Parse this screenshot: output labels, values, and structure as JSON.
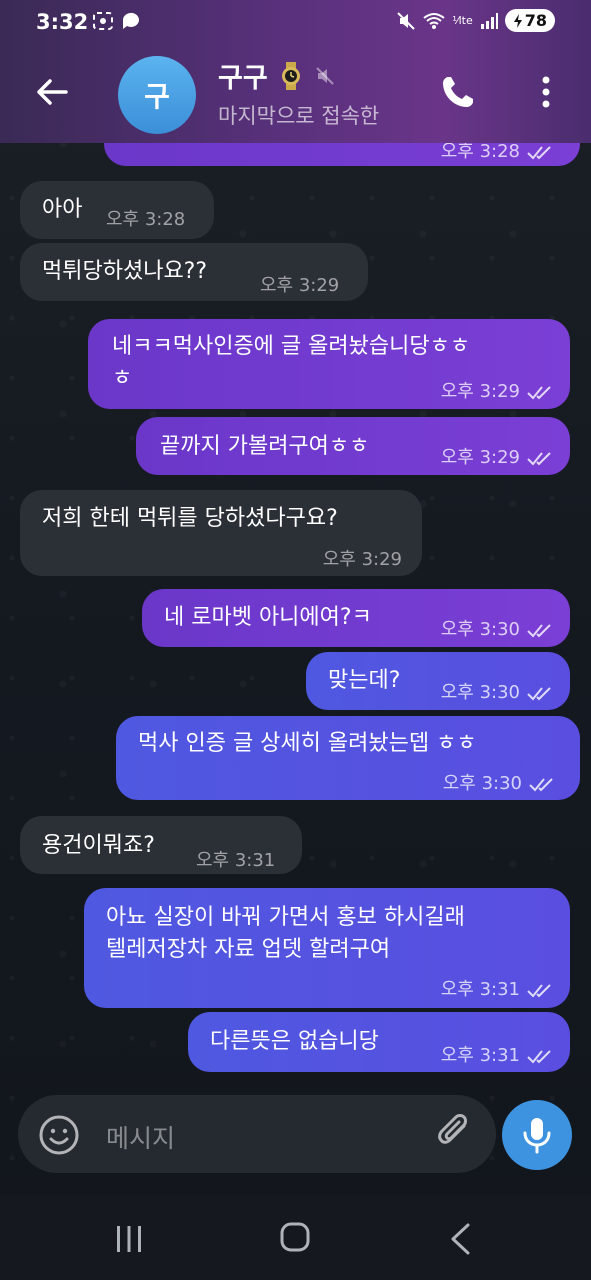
{
  "status_bar": {
    "time": "3:32",
    "network": "⅟lte",
    "battery": "78"
  },
  "header": {
    "avatar_letter": "구",
    "contact_name": "구구",
    "contact_status": "마지막으로 접속한 ",
    "colors": {
      "gradient_start": "#3a2a55",
      "gradient_end": "#6a3589"
    }
  },
  "messages": [
    {
      "dir": "out",
      "text": "",
      "time": "오후 3:28"
    },
    {
      "dir": "in",
      "text": "아아",
      "time": "오후 3:28"
    },
    {
      "dir": "in",
      "text": "먹튀당하셨나요??",
      "time": "오후 3:29"
    },
    {
      "dir": "out",
      "line1": "네ㅋㅋ먹사인증에 글 올려놨습니당ㅎㅎ",
      "line2": "ㅎ",
      "time": "오후 3:29"
    },
    {
      "dir": "out",
      "text": "끝까지 가볼려구여ㅎㅎ",
      "time": "오후 3:29"
    },
    {
      "dir": "in",
      "text": "저희 한테 먹튀를 당하셨다구요?",
      "time": "오후 3:29"
    },
    {
      "dir": "out",
      "text": "네 로마벳 아니에여?ㅋ",
      "time": "오후 3:30"
    },
    {
      "dir": "out",
      "text": "맞는데?",
      "time": "오후 3:30"
    },
    {
      "dir": "out",
      "text": "먹사 인증 글 상세히 올려놨는뎁 ㅎㅎ",
      "time": "오후 3:30"
    },
    {
      "dir": "in",
      "text": "용건이뭐죠?",
      "time": "오후 3:31"
    },
    {
      "dir": "out",
      "line1": "아뇨 실장이 바꿔 가면서 홍보 하시길래",
      "line2": "텔레저장차 자료 업뎃 할려구여",
      "time": "오후 3:31"
    },
    {
      "dir": "out",
      "text": "다른뜻은 없습니당",
      "time": "오후 3:31"
    }
  ],
  "composer": {
    "placeholder": "메시지"
  },
  "icons": {
    "back": "back-arrow-icon",
    "call": "phone-icon",
    "menu": "more-vert-icon",
    "emoji": "emoji-icon",
    "attach": "paperclip-icon",
    "mic": "mic-icon",
    "read": "double-check-icon",
    "muted": "mute-icon"
  }
}
